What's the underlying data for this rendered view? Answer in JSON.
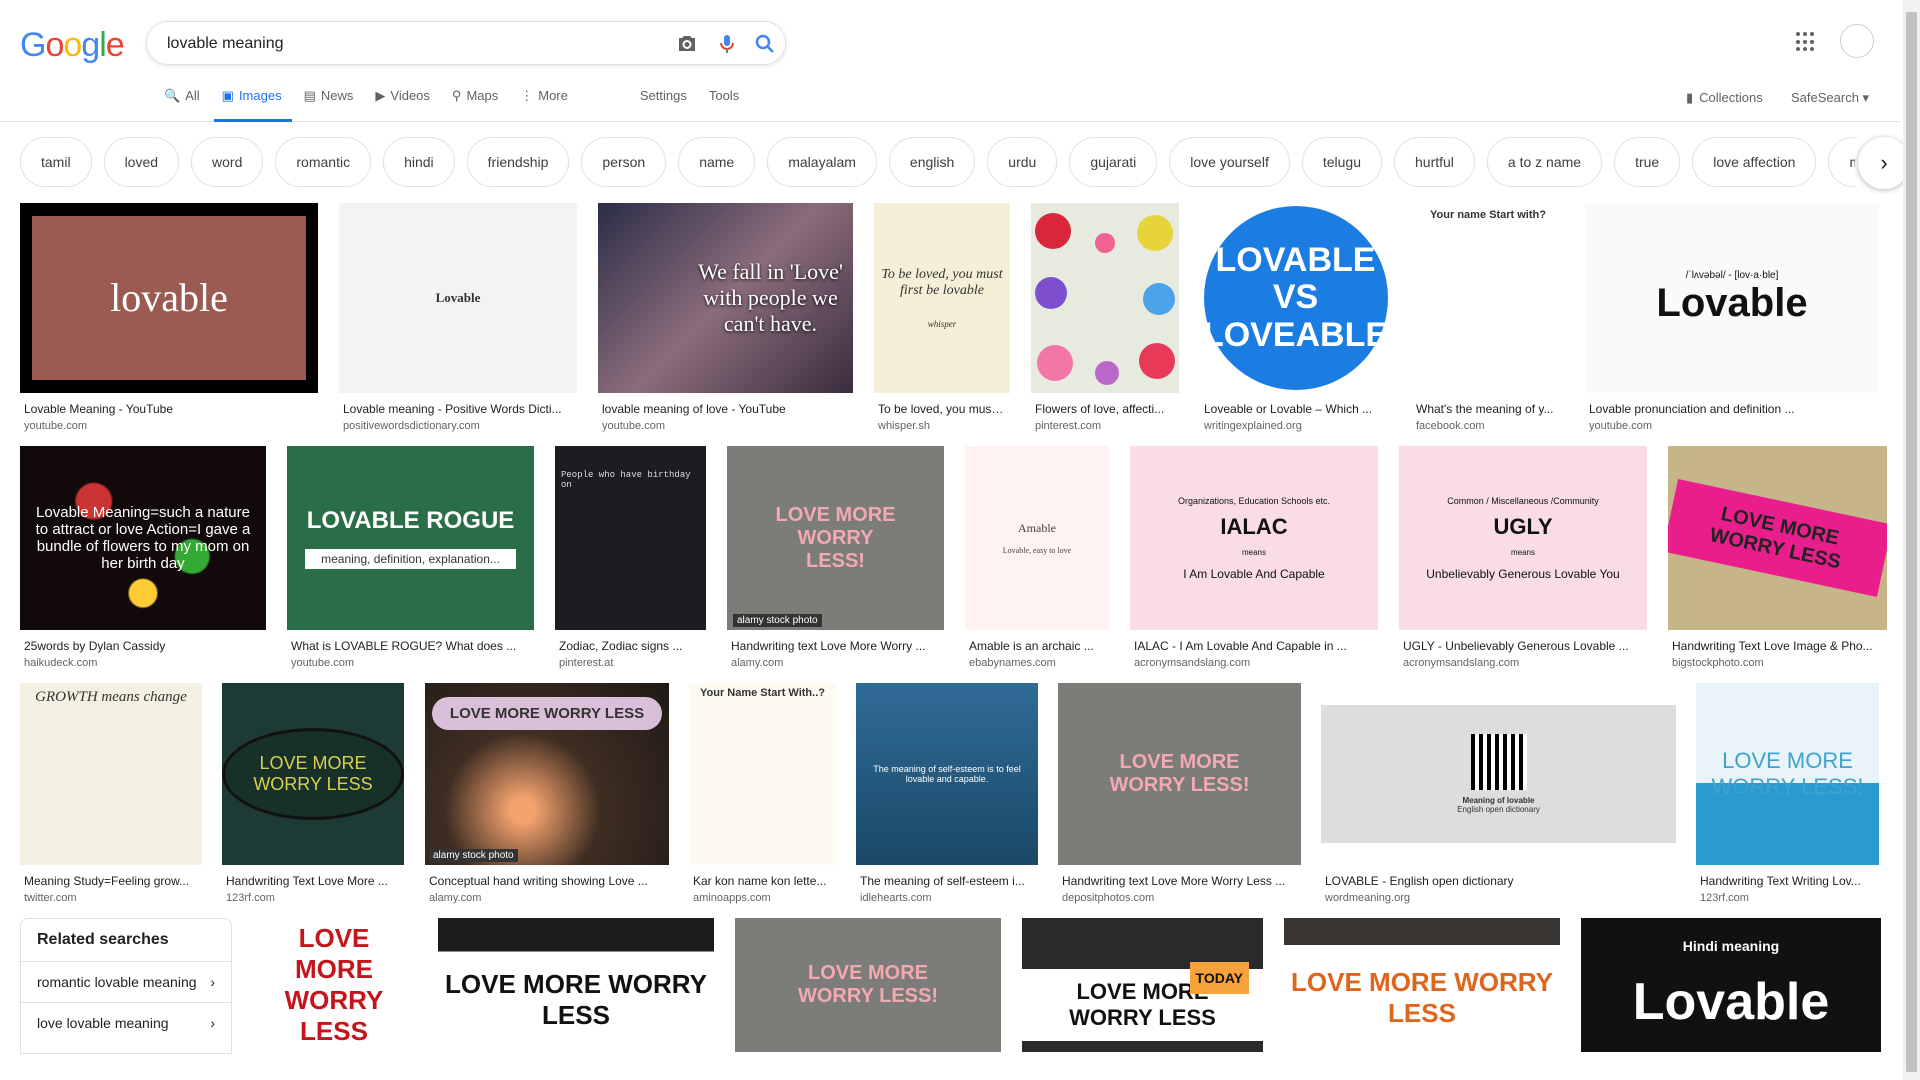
{
  "header": {
    "logo_letters": [
      "G",
      "o",
      "o",
      "g",
      "l",
      "e"
    ],
    "search_value": "lovable meaning",
    "icons": [
      "camera-icon",
      "microphone-icon",
      "search-icon",
      "apps-icon"
    ]
  },
  "tabs": [
    {
      "label": "All",
      "icon": "🔍",
      "active": false
    },
    {
      "label": "Images",
      "icon": "▣",
      "active": true
    },
    {
      "label": "News",
      "icon": "▤",
      "active": false
    },
    {
      "label": "Videos",
      "icon": "▶",
      "active": false
    },
    {
      "label": "Maps",
      "icon": "⚲",
      "active": false
    },
    {
      "label": "More",
      "icon": "⋮",
      "active": false
    }
  ],
  "tools": {
    "settings": "Settings",
    "tools": "Tools",
    "collections": "Collections",
    "safesearch": "SafeSearch ▾"
  },
  "chips": [
    "tamil",
    "loved",
    "word",
    "romantic",
    "hindi",
    "friendship",
    "person",
    "name",
    "malayalam",
    "english",
    "urdu",
    "gujarati",
    "love yourself",
    "telugu",
    "hurtful",
    "a to z name",
    "true",
    "love affection",
    "marathi"
  ],
  "rows": [
    [
      {
        "caption": "Lovable Meaning - YouTube",
        "source": "youtube.com",
        "thumb": "lovable"
      },
      {
        "caption": "Lovable meaning - Positive Words Dicti...",
        "source": "positivewordsdictionary.com",
        "thumb": "Lovable"
      },
      {
        "caption": "lovable meaning of love - YouTube",
        "source": "youtube.com",
        "thumb": "We fall in 'Love' with people we can't have."
      },
      {
        "caption": "To be loved, you must ...",
        "source": "whisper.sh",
        "thumb": "To be loved, you must first be lovable"
      },
      {
        "caption": "Flowers of love, affecti...",
        "source": "pinterest.com",
        "thumb": ""
      },
      {
        "caption": "Loveable or Lovable – Which ...",
        "source": "writingexplained.org",
        "thumb": "LOVABLE VS LOVEABLE"
      },
      {
        "caption": "What's the meaning of y...",
        "source": "facebook.com",
        "thumb": "Your name Start with?"
      },
      {
        "caption": "Lovable pronunciation and definition ...",
        "source": "youtube.com",
        "thumb": "Lovable"
      }
    ],
    [
      {
        "caption": "25words by Dylan Cassidy",
        "source": "haikudeck.com",
        "thumb": "Lovable Meaning=such a nature to attract or love Action=I gave a bundle of flowers to my mom on her birth day"
      },
      {
        "caption": "What is LOVABLE ROGUE? What does ...",
        "source": "youtube.com",
        "thumb": "LOVABLE ROGUE"
      },
      {
        "caption": "Zodiac, Zodiac signs ...",
        "source": "pinterest.at",
        "thumb": "People who have birthday on"
      },
      {
        "caption": "Handwriting text Love More Worry ...",
        "source": "alamy.com",
        "thumb": "LOVE MORE WORRY LESS!"
      },
      {
        "caption": "Amable is an archaic ...",
        "source": "ebabynames.com",
        "thumb": "Amable"
      },
      {
        "caption": "IALAC - I Am Lovable And Capable in ...",
        "source": "acronymsandslang.com",
        "thumb": "IALAC"
      },
      {
        "caption": "UGLY - Unbelievably Generous Lovable ...",
        "source": "acronymsandslang.com",
        "thumb": "UGLY"
      },
      {
        "caption": "Handwriting Text Love Image & Pho...",
        "source": "bigstockphoto.com",
        "thumb": "LOVE MORE WORRY LESS"
      }
    ],
    [
      {
        "caption": "Meaning Study=Feeling grow...",
        "source": "twitter.com",
        "thumb": "GROWTH means change"
      },
      {
        "caption": "Handwriting Text Love More ...",
        "source": "123rf.com",
        "thumb": "LOVE MORE WORRY LESS"
      },
      {
        "caption": "Conceptual hand writing showing Love ...",
        "source": "alamy.com",
        "thumb": "LOVE MORE WORRY LESS"
      },
      {
        "caption": "Kar kon name kon lette...",
        "source": "aminoapps.com",
        "thumb": "Your Name Start With..?"
      },
      {
        "caption": "The meaning of self-esteem i...",
        "source": "idlehearts.com",
        "thumb": "The meaning of self-esteem is to feel lovable and capable."
      },
      {
        "caption": "Handwriting text Love More Worry Less ...",
        "source": "depositphotos.com",
        "thumb": "LOVE MORE WORRY LESS!"
      },
      {
        "caption": "LOVABLE - English open dictionary",
        "source": "wordmeaning.org",
        "thumb": "Meaning of lovable"
      },
      {
        "caption": "Handwriting Text Writing Lov...",
        "source": "123rf.com",
        "thumb": "LOVE MORE WORRY LESS!"
      }
    ],
    [
      {
        "caption": "",
        "source": "",
        "thumb": "LOVE MORE WORRY LESS"
      },
      {
        "caption": "",
        "source": "",
        "thumb": "LOVE MORE WORRY LESS"
      },
      {
        "caption": "",
        "source": "",
        "thumb": "LOVE MORE WORRY LESS!"
      },
      {
        "caption": "",
        "source": "",
        "thumb": "LOVE MORE WORRY LESS"
      },
      {
        "caption": "",
        "source": "",
        "thumb": "LOVE MORE WORRY LESS"
      },
      {
        "caption": "",
        "source": "",
        "thumb": "Lovable"
      }
    ]
  ],
  "related": {
    "title": "Related searches",
    "items": [
      "romantic lovable meaning",
      "love lovable meaning"
    ]
  },
  "extras": {
    "whisper": "whisper",
    "alamy": "alamy stock photo",
    "ialac_top": "Organizations, Education Schools etc.",
    "ialac_means": "means",
    "ialac_full": "I Am Lovable And Capable",
    "ugly_top": "Common / Miscellaneous /Community",
    "ugly_full": "Unbelievably Generous Lovable You",
    "rogue_sub": "meaning, definition, explanation...",
    "pron": "/ˈlʌvəbəl/ - [lov·a·ble]",
    "dict_sub": "English open dictionary",
    "hindi": "Hindi meaning",
    "today": "TODAY",
    "amable_sub": "Lovable, easy to love"
  }
}
